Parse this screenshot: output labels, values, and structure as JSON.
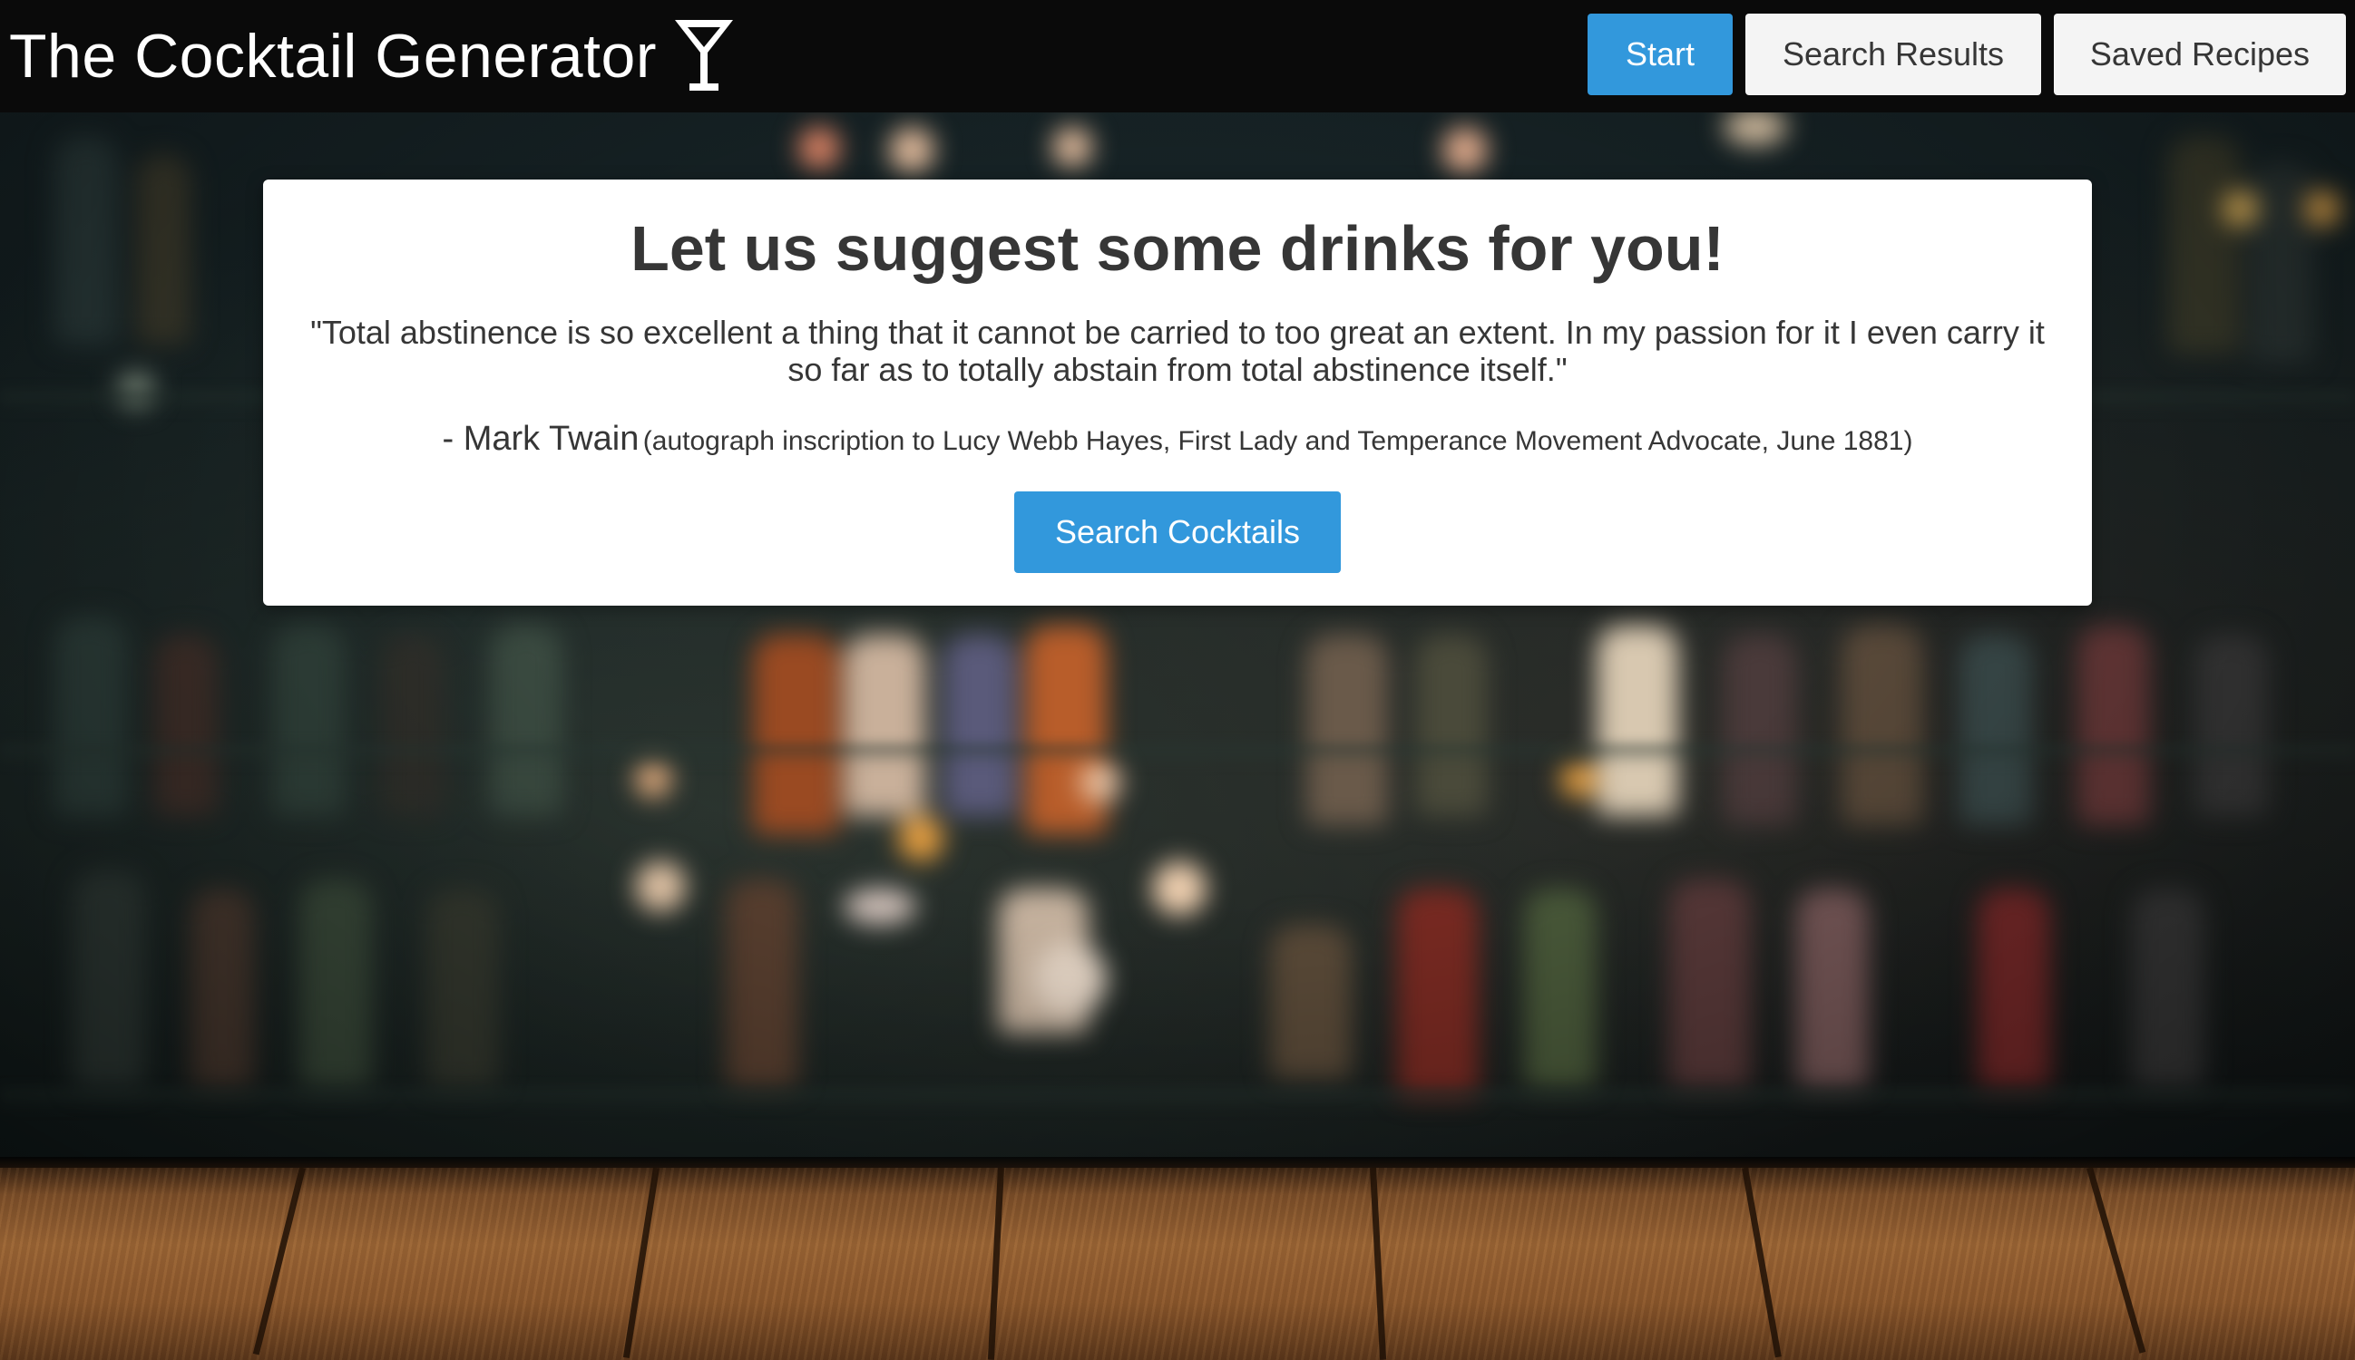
{
  "header": {
    "title": "The Cocktail Generator",
    "icon": "martini-glass-icon",
    "nav": {
      "start_label": "Start",
      "search_results_label": "Search Results",
      "saved_recipes_label": "Saved Recipes"
    }
  },
  "hero": {
    "heading": "Let us suggest some drinks for you!",
    "quote": "\"Total abstinence is so excellent a thing that it cannot be carried to too great an extent. In my passion for it I even carry it so far as to totally abstain from total abstinence itself.\"",
    "author": "- Mark Twain",
    "source": "(autograph inscription to Lucy Webb Hayes, First Lady and Temperance Movement Advocate, June 1881)",
    "button_label": "Search Cocktails"
  },
  "colors": {
    "header_bg": "#0a0a0a",
    "primary": "#3298dc",
    "light_button": "#f4f4f4",
    "text": "#363636"
  }
}
